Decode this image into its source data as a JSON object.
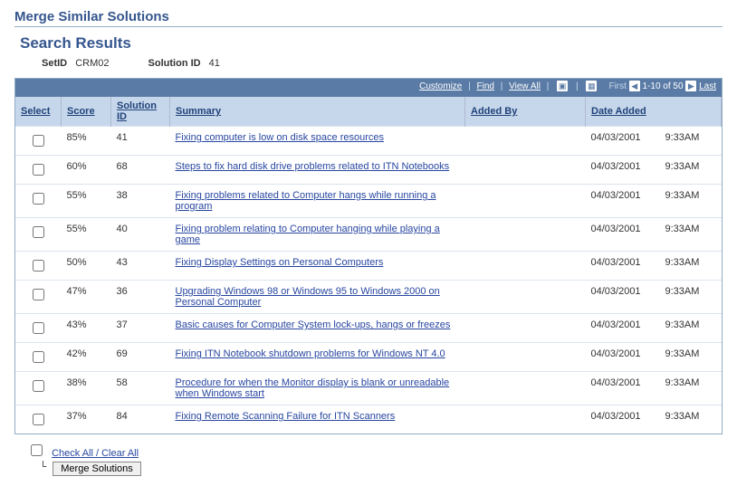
{
  "page_title": "Merge Similar Solutions",
  "section_title": "Search Results",
  "criteria": {
    "setid_label": "SetID",
    "setid_value": "CRM02",
    "solid_label": "Solution ID",
    "solid_value": "41"
  },
  "toolbar": {
    "customize": "Customize",
    "find": "Find",
    "view_all": "View All",
    "first": "First",
    "range": "1-10 of 50",
    "last": "Last"
  },
  "columns": {
    "select": "Select",
    "score": "Score",
    "solution_id": "Solution ID",
    "summary": "Summary",
    "added_by": "Added By",
    "date_added": "Date Added"
  },
  "rows": [
    {
      "score": "85%",
      "sol": "41",
      "summary": "Fixing computer is low on disk space resources",
      "added_by": "",
      "date": "04/03/2001",
      "time": "9:33AM"
    },
    {
      "score": "60%",
      "sol": "68",
      "summary": "Steps to fix hard disk drive problems related to ITN Notebooks",
      "added_by": "",
      "date": "04/03/2001",
      "time": "9:33AM"
    },
    {
      "score": "55%",
      "sol": "38",
      "summary": "Fixing problems related to Computer hangs while running a program",
      "added_by": "",
      "date": "04/03/2001",
      "time": "9:33AM"
    },
    {
      "score": "55%",
      "sol": "40",
      "summary": "Fixing problem relating to Computer hanging while playing a game",
      "added_by": "",
      "date": "04/03/2001",
      "time": "9:33AM"
    },
    {
      "score": "50%",
      "sol": "43",
      "summary": "Fixing Display Settings on Personal Computers",
      "added_by": "",
      "date": "04/03/2001",
      "time": "9:33AM"
    },
    {
      "score": "47%",
      "sol": "36",
      "summary": "Upgrading Windows 98 or Windows 95 to Windows 2000 on Personal Computer",
      "added_by": "",
      "date": "04/03/2001",
      "time": "9:33AM"
    },
    {
      "score": "43%",
      "sol": "37",
      "summary": "Basic causes for Computer System lock-ups, hangs or freezes",
      "added_by": "",
      "date": "04/03/2001",
      "time": "9:33AM"
    },
    {
      "score": "42%",
      "sol": "69",
      "summary": "Fixing ITN Notebook shutdown problems for Windows NT 4.0",
      "added_by": "",
      "date": "04/03/2001",
      "time": "9:33AM"
    },
    {
      "score": "38%",
      "sol": "58",
      "summary": "Procedure for when the Monitor display is blank or unreadable when Windows start",
      "added_by": "",
      "date": "04/03/2001",
      "time": "9:33AM"
    },
    {
      "score": "37%",
      "sol": "84",
      "summary": "Fixing Remote Scanning Failure for ITN Scanners",
      "added_by": "",
      "date": "04/03/2001",
      "time": "9:33AM"
    }
  ],
  "footer": {
    "check_all": "Check All / Clear All",
    "merge_btn": "Merge Solutions"
  }
}
